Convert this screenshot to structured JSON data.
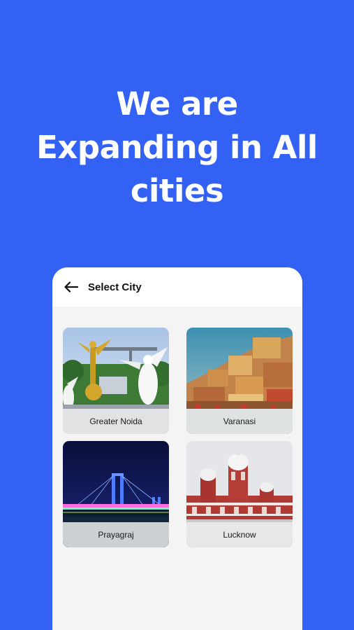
{
  "headline": {
    "line1": "We are",
    "line2": "Expanding in All",
    "line3": "cities"
  },
  "app_bar": {
    "back_icon": "arrow-left-icon",
    "title": "Select City"
  },
  "cities": [
    {
      "name": "Greater Noida"
    },
    {
      "name": "Varanasi"
    },
    {
      "name": "Prayagraj"
    },
    {
      "name": "Lucknow"
    }
  ],
  "colors": {
    "background": "#3361f3",
    "panel": "#f4f4f4",
    "app_bar": "#ffffff",
    "headline_text": "#ffffff"
  }
}
